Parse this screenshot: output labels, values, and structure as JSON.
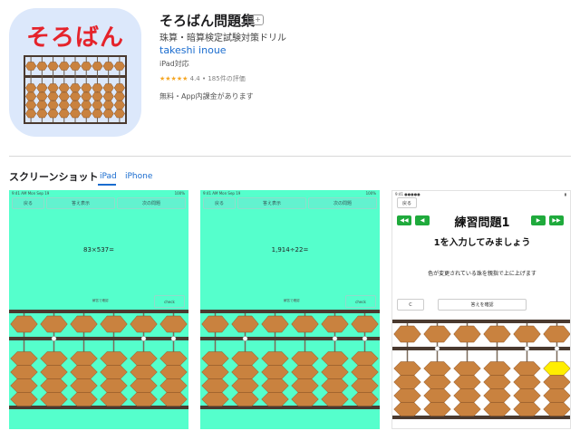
{
  "app": {
    "icon_title": "そろばん",
    "title": "そろばん問題集",
    "age_rating": "4+",
    "subtitle": "珠算・暗算検定試験対策ドリル",
    "developer": "takeshi inoue",
    "device_support": "iPad対応",
    "stars": "★★★★★",
    "rating_text": "4.4 • 185件の評価",
    "price_text": "無料・App内課金があります"
  },
  "screenshots_section": {
    "title": "スクリーンショット",
    "tabs": [
      "iPad",
      "iPhone"
    ],
    "active_tab": "iPad"
  },
  "screenshots": [
    {
      "status_left": "9:41 AM   Mon Sep 19",
      "status_right": "100%",
      "buttons": [
        "戻る",
        "答え表示",
        "次の問題"
      ],
      "problem": "83×537=",
      "answer_label": "解答で確認",
      "answer_button": "check"
    },
    {
      "status_left": "9:41 AM   Mon Sep 19",
      "status_right": "100%",
      "buttons": [
        "戻る",
        "答え表示",
        "次の問題"
      ],
      "problem": "1,914÷22=",
      "answer_label": "解答で確認",
      "answer_button": "check"
    },
    {
      "status_left": "9:41  ●●●●●",
      "status_right": "▮",
      "back": "戻る",
      "arrows": [
        "◀◀",
        "◀",
        "▶",
        "▶▶"
      ],
      "lesson_title": "練習問題1",
      "lesson_sub": "1を入力してみましょう",
      "lesson_note": "色が変更されている珠を親指で上に上げます",
      "clear_button": "C",
      "check_button": "答えを確認"
    }
  ],
  "colors": {
    "shot_bg": "#55ffcc",
    "bead": "#c9823f",
    "frame": "#4a3a30",
    "accent": "#1a6ccf",
    "icon_red": "#e5232b",
    "highlight_bead": "#ffee00"
  }
}
